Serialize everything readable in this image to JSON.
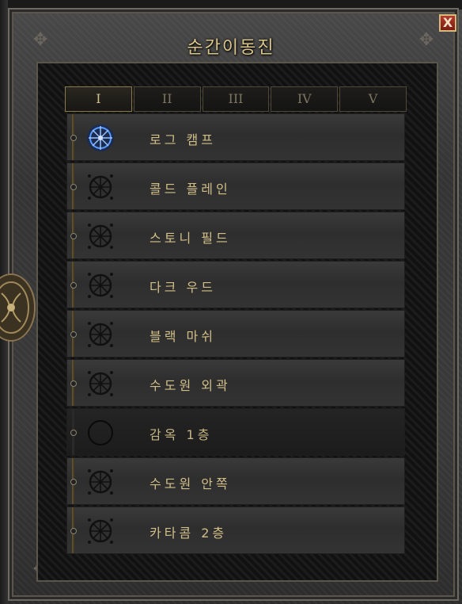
{
  "window": {
    "title": "순간이동진",
    "close_label": "X"
  },
  "tabs": [
    {
      "label": "I",
      "active": true
    },
    {
      "label": "II",
      "active": false
    },
    {
      "label": "III",
      "active": false
    },
    {
      "label": "IV",
      "active": false
    },
    {
      "label": "V",
      "active": false
    }
  ],
  "waypoints": [
    {
      "label": "로그 캠프",
      "state": "active"
    },
    {
      "label": "콜드 플레인",
      "state": "unlocked"
    },
    {
      "label": "스토니 필드",
      "state": "unlocked"
    },
    {
      "label": "다크 우드",
      "state": "unlocked"
    },
    {
      "label": "블랙 마쉬",
      "state": "unlocked"
    },
    {
      "label": "수도원 외곽",
      "state": "unlocked"
    },
    {
      "label": "감옥 1층",
      "state": "locked"
    },
    {
      "label": "수도원 안쪽",
      "state": "unlocked"
    },
    {
      "label": "카타콤 2층",
      "state": "unlocked"
    }
  ],
  "colors": {
    "label_gold": "#d2bf88",
    "active_glow": "#3f7fff",
    "close_red": "#b23a2c"
  }
}
